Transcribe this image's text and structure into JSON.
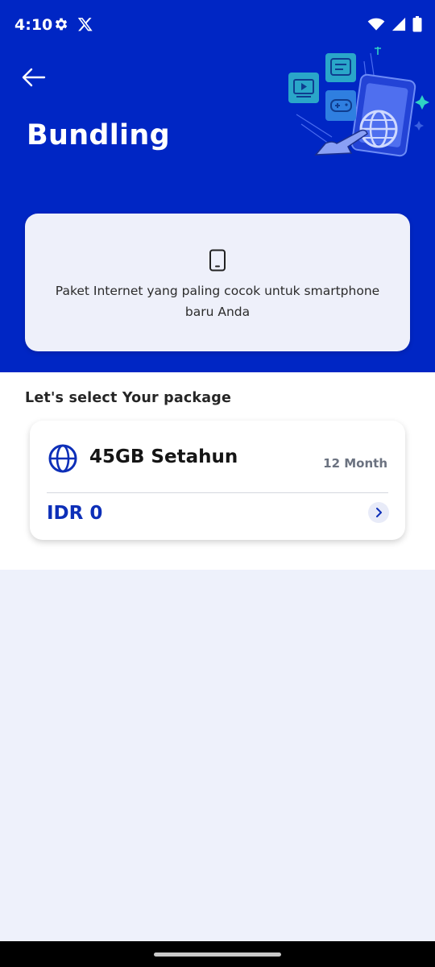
{
  "status_bar": {
    "time": "4:10",
    "left_icons": [
      "gear-icon",
      "x-logo-icon"
    ],
    "right_icons": [
      "wifi-icon",
      "signal-icon",
      "battery-icon"
    ]
  },
  "header": {
    "title": "Bundling",
    "background_color": "#0026c4"
  },
  "info_card": {
    "icon": "smartphone-icon",
    "text": "Paket Internet yang paling cocok untuk smartphone baru Anda"
  },
  "packages_section": {
    "title": "Let's select Your package",
    "packages": [
      {
        "icon": "globe-icon",
        "name": "45GB Setahun",
        "duration": "12 Month",
        "price": "IDR 0"
      }
    ]
  },
  "colors": {
    "primary": "#0026c4",
    "price": "#0d2fb8",
    "page_background": "#eef1fb"
  }
}
